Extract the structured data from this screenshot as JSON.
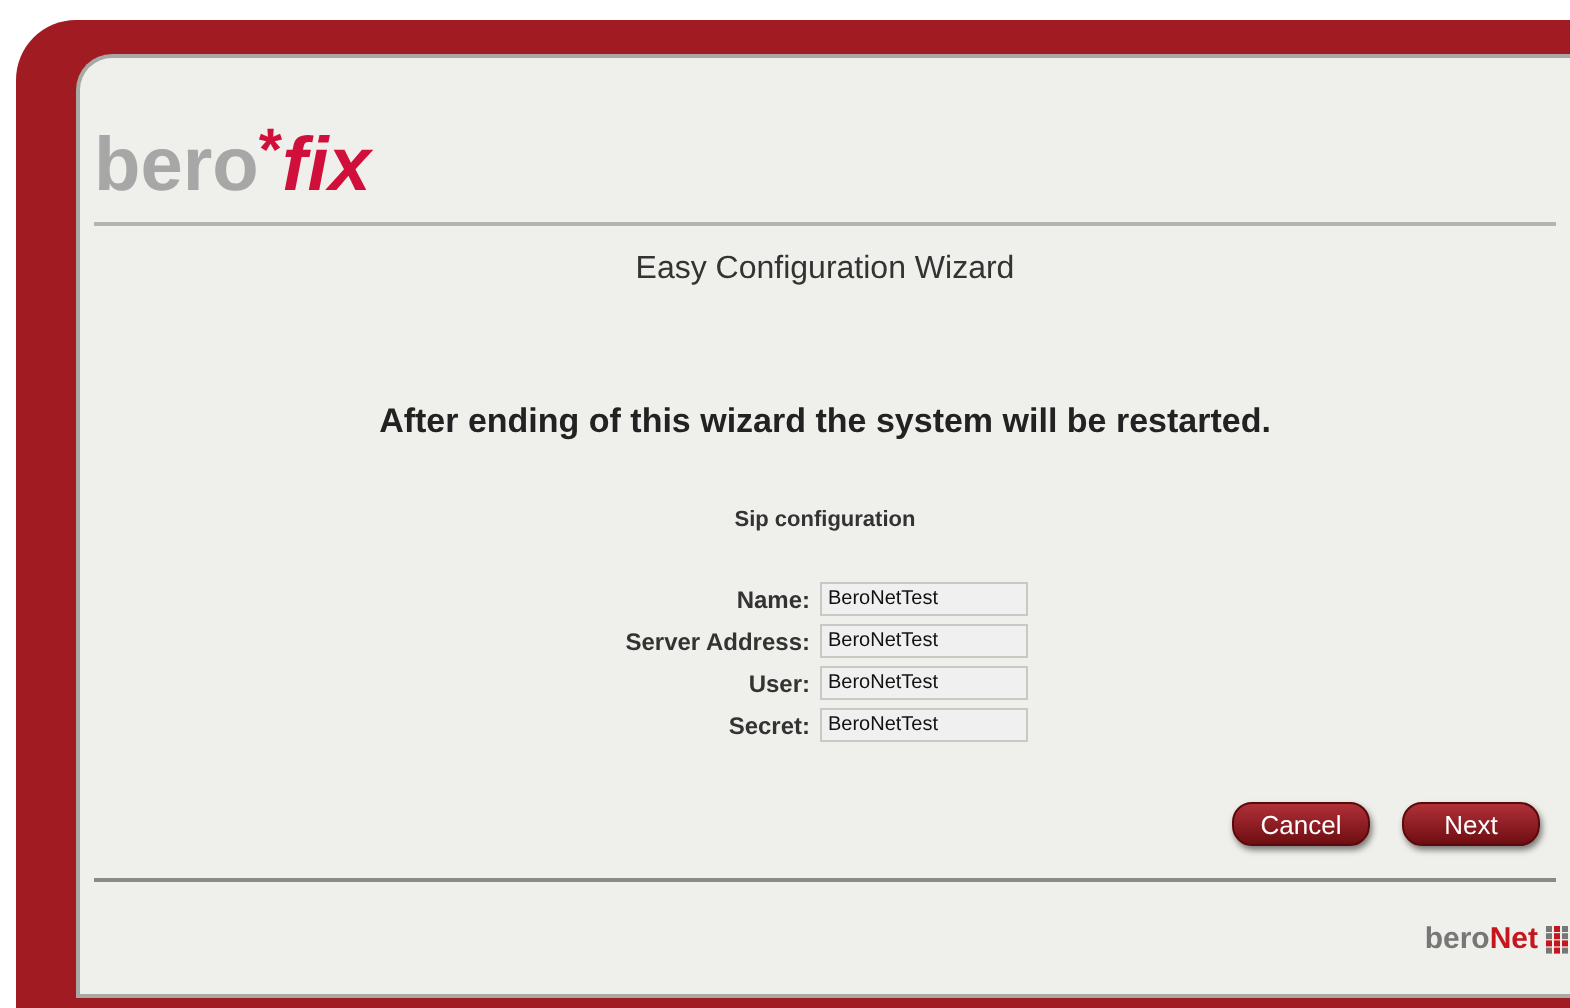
{
  "logo": {
    "prefix": "bero",
    "mark": "*",
    "suffix": "fix"
  },
  "wizard_title": "Easy Configuration Wizard",
  "notice": "After ending of this wizard the system will be restarted.",
  "section_title": "Sip configuration",
  "fields": [
    {
      "label": "Name:",
      "value": "BeroNetTest"
    },
    {
      "label": "Server Address:",
      "value": "BeroNetTest"
    },
    {
      "label": "User:",
      "value": "BeroNetTest"
    },
    {
      "label": "Secret:",
      "value": "BeroNetTest"
    }
  ],
  "buttons": [
    "Cancel",
    "Next"
  ],
  "footer_logo": {
    "prefix": "bero",
    "suffix": "Net"
  }
}
